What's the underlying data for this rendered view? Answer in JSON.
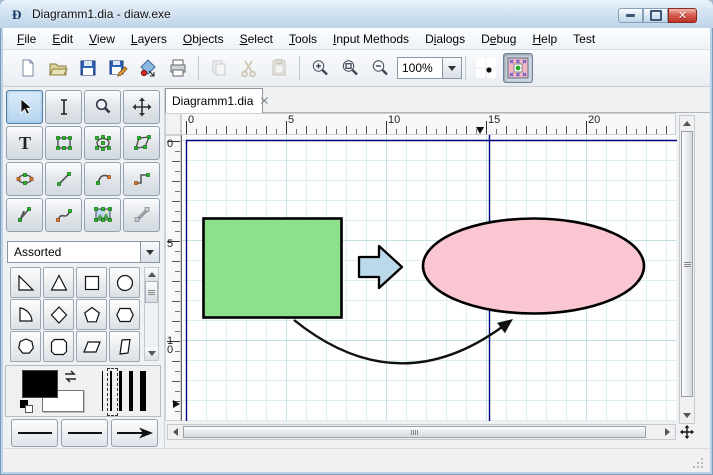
{
  "window": {
    "title": "Diagramm1.dia - diaw.exe"
  },
  "menu": {
    "items": [
      {
        "pre": "",
        "key": "F",
        "post": "ile"
      },
      {
        "pre": "",
        "key": "E",
        "post": "dit"
      },
      {
        "pre": "",
        "key": "V",
        "post": "iew"
      },
      {
        "pre": "",
        "key": "L",
        "post": "ayers"
      },
      {
        "pre": "",
        "key": "O",
        "post": "bjects"
      },
      {
        "pre": "",
        "key": "S",
        "post": "elect"
      },
      {
        "pre": "",
        "key": "T",
        "post": "ools"
      },
      {
        "pre": "",
        "key": "I",
        "post": "nput Methods"
      },
      {
        "pre": "D",
        "key": "i",
        "post": "alogs"
      },
      {
        "pre": "D",
        "key": "e",
        "post": "bug"
      },
      {
        "pre": "",
        "key": "H",
        "post": "elp"
      },
      {
        "pre": "Test",
        "key": "",
        "post": ""
      }
    ]
  },
  "toolbar": {
    "zoom_value": "100%"
  },
  "toolbox": {
    "text_glyph": "T",
    "sheet_selected": "Assorted"
  },
  "tab": {
    "label": "Diagramm1.dia",
    "close_glyph": "✕"
  },
  "rulers": {
    "h": [
      "0",
      "5",
      "10",
      "15",
      "20"
    ],
    "v": [
      "0",
      "5",
      "10"
    ]
  },
  "canvas": {
    "rect_fill": "#8ce28c",
    "rect_stroke": "#000000",
    "arrow_fill": "#bad9ea",
    "arrow_stroke": "#000000",
    "ellipse_fill": "#f9c6d1",
    "ellipse_stroke": "#000000",
    "connector_stroke": "#111111",
    "page_line_color": "#00007c",
    "connection_marker_color": "#4d4dcc",
    "grid_minor": "#dcf0f1",
    "grid_major": "#c2e2e4",
    "selected_tool_accent": "#b6d4ef"
  },
  "statusbar": {
    "text": ""
  }
}
